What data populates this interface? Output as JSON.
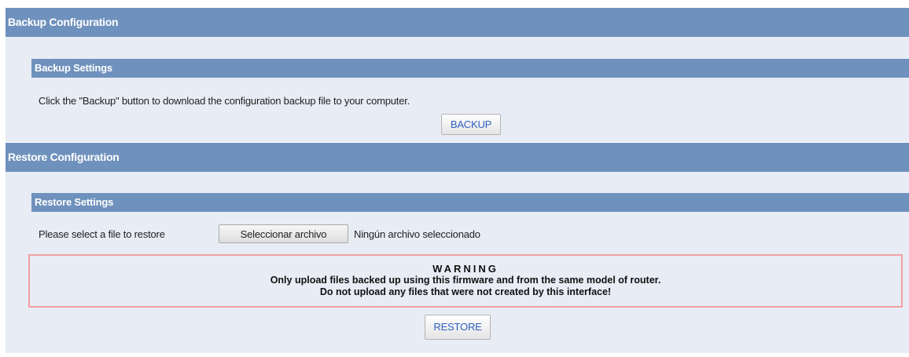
{
  "backup": {
    "section_title": "Backup Configuration",
    "settings_title": "Backup Settings",
    "description": "Click the \"Backup\" button to download the configuration backup file to your computer.",
    "button_label": "BACKUP"
  },
  "restore": {
    "section_title": "Restore Configuration",
    "settings_title": "Restore Settings",
    "file_label": "Please select a file to restore",
    "file_button_label": "Seleccionar archivo",
    "file_status": "Ningún archivo seleccionado",
    "warning": {
      "title": "WARNING",
      "line1": "Only upload files backed up using this firmware and from the same model of router.",
      "line2": "Do not upload any files that were not created by this interface!"
    },
    "button_label": "RESTORE"
  },
  "colors": {
    "header": "#6f91bd",
    "panel": "#e8ecf5",
    "warning_border": "#f0a0a0",
    "button_text": "#2f5fc4"
  }
}
